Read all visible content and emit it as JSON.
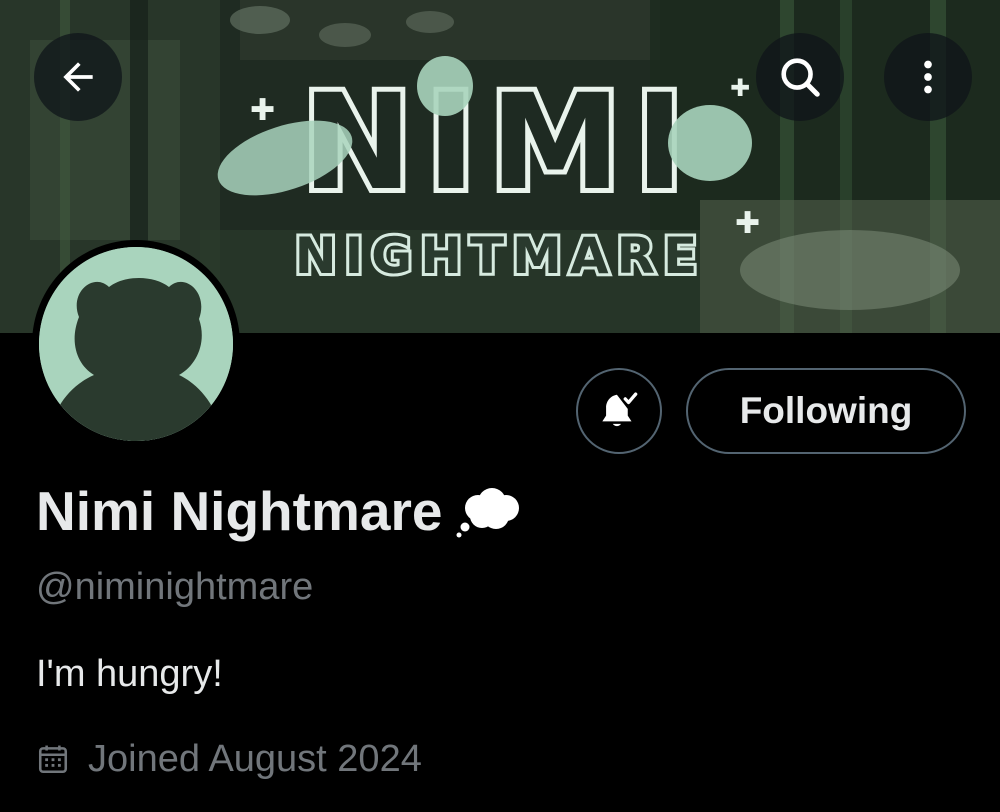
{
  "header": {
    "back_icon": "arrow-left-icon",
    "search_icon": "search-icon",
    "more_icon": "more-vertical-icon"
  },
  "banner": {
    "logo_title": "NIMI",
    "logo_subtitle": "NIGHTMARE",
    "accent_color": "#a9d4bd"
  },
  "actions": {
    "notify_icon": "bell-subscribed-icon",
    "following_label": "Following"
  },
  "profile": {
    "display_name": "Nimi Nightmare",
    "name_emoji": "thought-bubble-emoji",
    "handle": "@niminightmare",
    "bio": "I'm hungry!",
    "joined_icon": "calendar-icon",
    "joined": "Joined August 2024"
  },
  "colors": {
    "background": "#000000",
    "primary_text": "#e7e9ea",
    "secondary_text": "#71767b",
    "border": "#536471"
  }
}
